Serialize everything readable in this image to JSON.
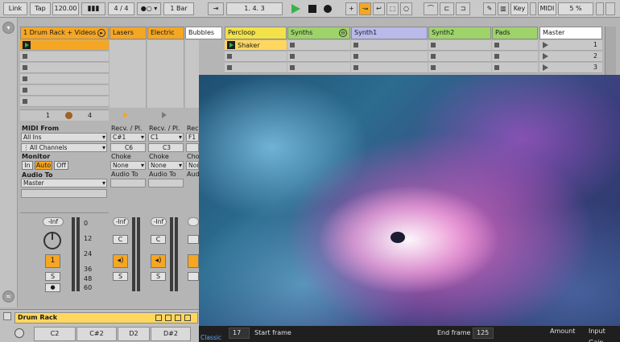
{
  "transport": {
    "link": "Link",
    "tap": "Tap",
    "tempo": "120.00",
    "signature": "4 / 4",
    "quantize": "1 Bar",
    "position": "1.    4.    3",
    "key": "Key",
    "midi": "MIDI",
    "cpu": "5 %"
  },
  "tracks": [
    {
      "name": "1 Drum Rack + Videos",
      "color": "#f5a623"
    },
    {
      "name": "Lasers",
      "color": "#f5a623"
    },
    {
      "name": "Electric",
      "color": "#f5a623"
    },
    {
      "name": "Bubbles",
      "color": "#ffffff"
    },
    {
      "name": "Percloop",
      "color": "#f3e14a"
    },
    {
      "name": "Synths",
      "color": "#9ed36a"
    },
    {
      "name": "Synth1",
      "color": "#b9b9ea"
    },
    {
      "name": "Synth2",
      "color": "#9ed36a"
    },
    {
      "name": "Pads",
      "color": "#9ed36a"
    },
    {
      "name": "Master",
      "color": "#ffffff"
    }
  ],
  "clips": {
    "shaker": "Shaker"
  },
  "scenes": [
    "1",
    "2",
    "3"
  ],
  "group_controls": {
    "scene_left": "1",
    "scene_right": "4"
  },
  "io": {
    "midi_from": "MIDI From",
    "all_ins": "All Ins",
    "all_channels": "All Channels",
    "monitor": "Monitor",
    "monitor_in": "In",
    "monitor_auto": "Auto",
    "monitor_off": "Off",
    "audio_to": "Audio To",
    "master": "Master",
    "recv": "Recv. / Pl.",
    "choke": "Choke",
    "none": "None"
  },
  "chains": [
    {
      "recv": "C#1",
      "play": "C6"
    },
    {
      "recv": "C1",
      "play": "C3"
    },
    {
      "recv": "F1",
      "play": ""
    }
  ],
  "mixer": {
    "volume": "-Inf",
    "scale": [
      "0",
      "12",
      "24",
      "36",
      "48",
      "60"
    ],
    "track_number": "1",
    "solo": "S",
    "cue": "C"
  },
  "device": {
    "title": "Drum Rack",
    "pads": [
      "C2",
      "C#2",
      "D2",
      "D#2"
    ]
  },
  "video_bar": {
    "mode": "Classic",
    "start_value": "17",
    "start_label": "Start frame",
    "end_label": "End frame",
    "end_value": "125",
    "amount": "Amount",
    "input_gain": "Input Gain"
  },
  "colors": {
    "accent": "#f5a623",
    "play_green": "#37b24d"
  }
}
